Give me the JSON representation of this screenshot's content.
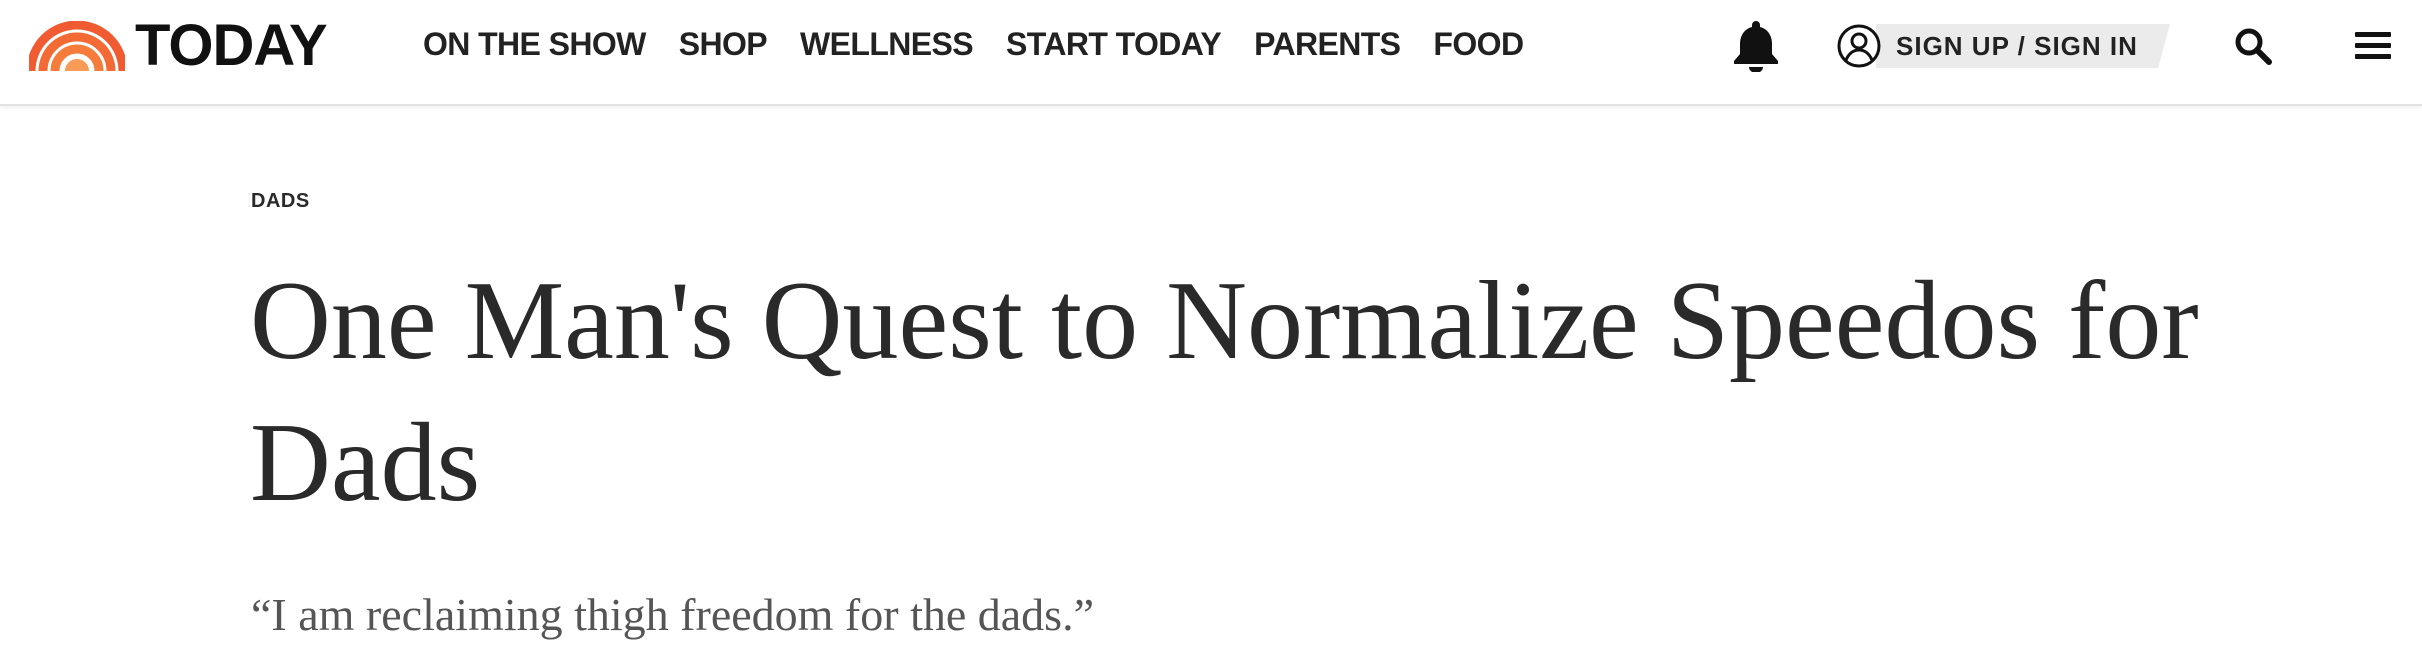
{
  "header": {
    "logo_text": "TODAY",
    "logo_colors": [
      "#f05b31",
      "#f67c3c",
      "#f79b57"
    ],
    "nav": [
      {
        "label": "ON THE SHOW"
      },
      {
        "label": "SHOP"
      },
      {
        "label": "WELLNESS"
      },
      {
        "label": "START TODAY"
      },
      {
        "label": "PARENTS"
      },
      {
        "label": "FOOD"
      }
    ],
    "icons": {
      "notifications": "bell-icon",
      "account": "user-circle-icon",
      "search": "search-icon",
      "menu": "hamburger-menu-icon"
    },
    "signin_label": "SIGN UP / SIGN IN"
  },
  "article": {
    "eyebrow": "DADS",
    "headline": "One Man's Quest to Normalize Speedos for Dads",
    "dek": "“I am reclaiming thigh freedom for the dads.”"
  },
  "colors": {
    "text": "#2a2a2a",
    "dek_text": "#555555",
    "signin_pill": "#ebebeb",
    "header_border": "#e2e2e2"
  }
}
